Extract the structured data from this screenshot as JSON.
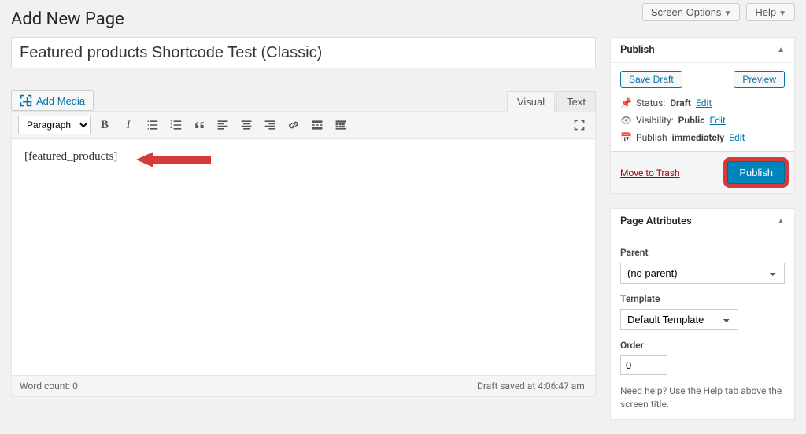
{
  "screen_options_label": "Screen Options",
  "help_label": "Help",
  "page_heading": "Add New Page",
  "title_value": "Featured products Shortcode Test (Classic)",
  "add_media_label": "Add Media",
  "tabs": {
    "visual": "Visual",
    "text": "Text"
  },
  "paragraph_select": "Paragraph",
  "editor_content": "[featured_products]",
  "word_count_label": "Word count: 0",
  "draft_saved_label": "Draft saved at 4:06:47 am.",
  "publish_box": {
    "title": "Publish",
    "save_draft": "Save Draft",
    "preview": "Preview",
    "status_label": "Status:",
    "status_value": "Draft",
    "visibility_label": "Visibility:",
    "visibility_value": "Public",
    "publish_label": "Publish",
    "publish_value": "immediately",
    "edit": "Edit",
    "trash": "Move to Trash",
    "publish_btn": "Publish"
  },
  "attributes_box": {
    "title": "Page Attributes",
    "parent_label": "Parent",
    "parent_value": "(no parent)",
    "template_label": "Template",
    "template_value": "Default Template",
    "order_label": "Order",
    "order_value": "0",
    "help_text": "Need help? Use the Help tab above the screen title."
  }
}
